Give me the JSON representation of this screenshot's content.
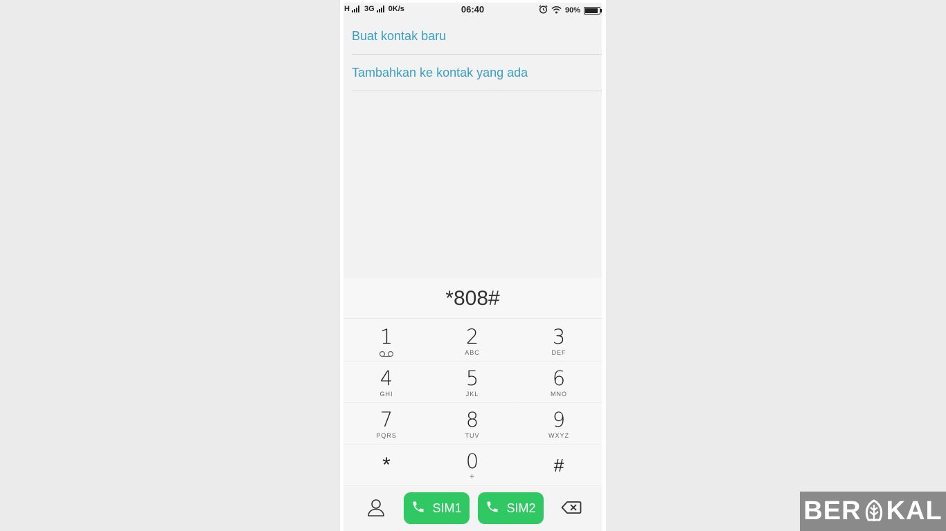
{
  "status_bar": {
    "network1": "H",
    "network2": "3G",
    "speed": "0K/s",
    "time": "06:40",
    "battery": "90%",
    "battery_level": 0.9
  },
  "options": {
    "new_contact": "Buat kontak baru",
    "add_existing": "Tambahkan ke kontak yang ada"
  },
  "dialer": {
    "number": "*808#",
    "keys": [
      {
        "digit": "1",
        "letters": ""
      },
      {
        "digit": "2",
        "letters": "ABC"
      },
      {
        "digit": "3",
        "letters": "DEF"
      },
      {
        "digit": "4",
        "letters": "GHI"
      },
      {
        "digit": "5",
        "letters": "JKL"
      },
      {
        "digit": "6",
        "letters": "MNO"
      },
      {
        "digit": "7",
        "letters": "PQRS"
      },
      {
        "digit": "8",
        "letters": "TUV"
      },
      {
        "digit": "9",
        "letters": "WXYZ"
      },
      {
        "digit": "*",
        "letters": ""
      },
      {
        "digit": "0",
        "letters": "+"
      },
      {
        "digit": "#",
        "letters": ""
      }
    ]
  },
  "buttons": {
    "sim1": "SIM1",
    "sim2": "SIM2"
  },
  "watermark": {
    "text_start": "BER",
    "text_end": "KAL"
  },
  "colors": {
    "accent": "#3a9fc7",
    "call": "#2fc862"
  }
}
